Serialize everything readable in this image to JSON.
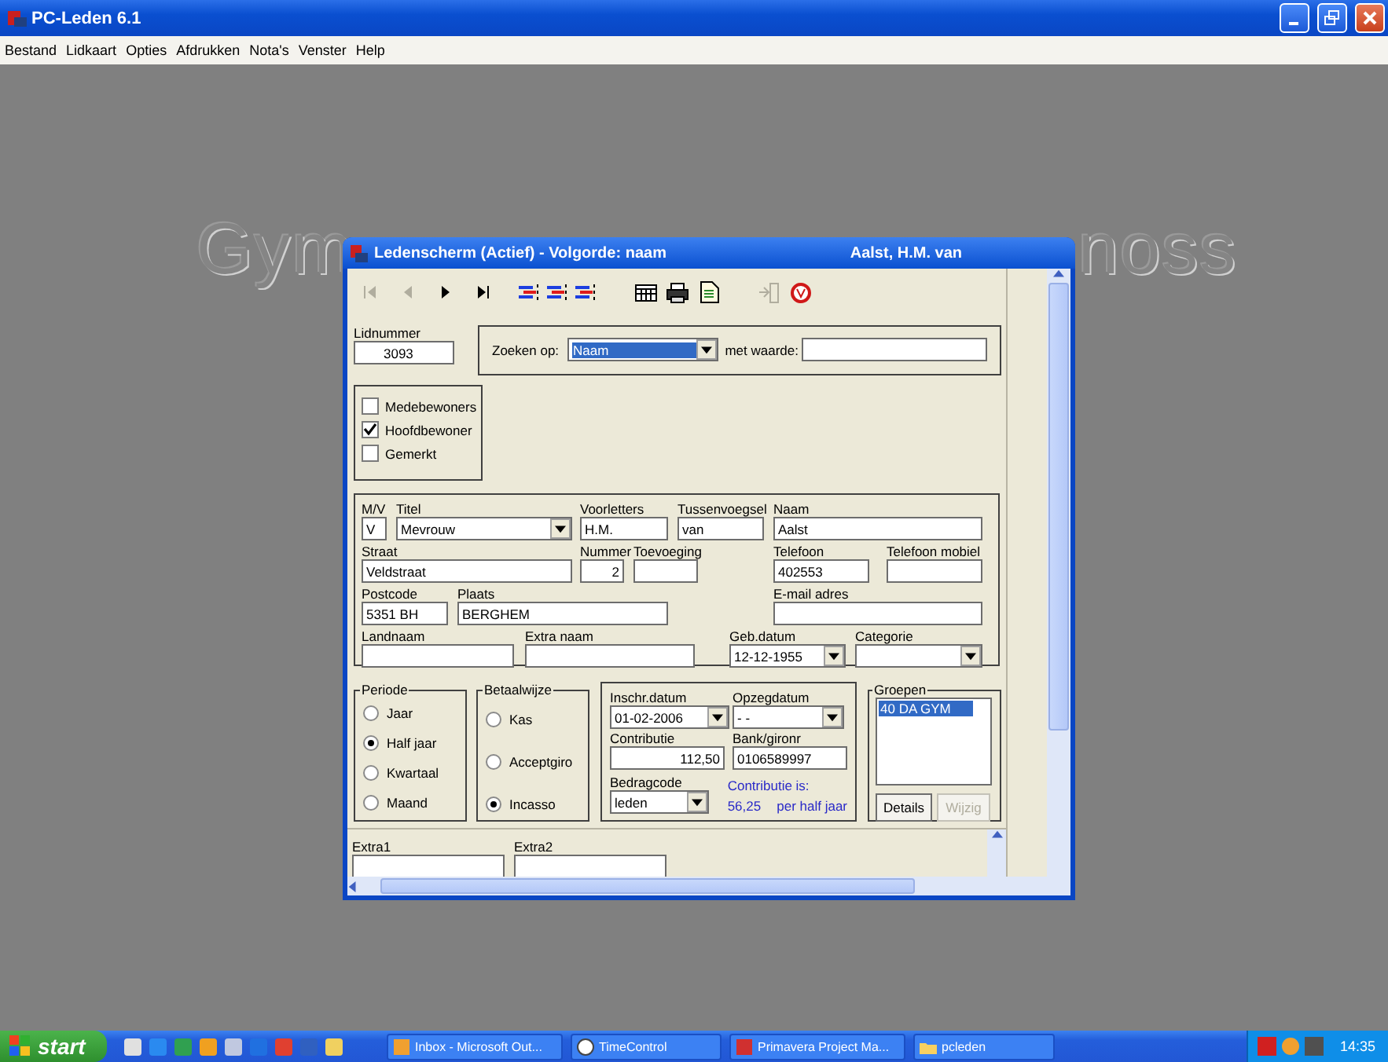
{
  "app": {
    "title": "PC-Leden 6.1"
  },
  "menu": [
    "Bestand",
    "Lidkaart",
    "Opties",
    "Afdrukken",
    "Nota's",
    "Venster",
    "Help"
  ],
  "desktop_title_parts": [
    "Gym",
    "noss"
  ],
  "child_window": {
    "title": "Ledenscherm (Actief) - Volgorde: naam",
    "member": "Aalst, H.M. van"
  },
  "toolbar": [
    {
      "kind": "first",
      "disabled": true
    },
    {
      "kind": "prev",
      "disabled": true
    },
    {
      "kind": "next",
      "disabled": false
    },
    {
      "kind": "last",
      "disabled": false
    },
    {
      "kind": "sort",
      "disabled": false
    },
    {
      "kind": "sort",
      "disabled": false
    },
    {
      "kind": "sort",
      "disabled": false
    },
    {
      "kind": "grid",
      "disabled": false
    },
    {
      "kind": "print",
      "disabled": false
    },
    {
      "kind": "doc",
      "disabled": false
    },
    {
      "kind": "exit",
      "disabled": true
    },
    {
      "kind": "stop",
      "disabled": false
    }
  ],
  "lidnummer": {
    "label": "Lidnummer",
    "value": "3093"
  },
  "search": {
    "label": "Zoeken op:",
    "value": "Naam",
    "highlighted": true,
    "value_label": "met waarde:"
  },
  "flags": [
    {
      "label": "Medebewoners",
      "checked": false
    },
    {
      "label": "Hoofdbewoner",
      "checked": true
    },
    {
      "label": "Gemerkt",
      "checked": false
    }
  ],
  "person": {
    "lines": [
      {
        "fields": [
          {
            "label": "M/V",
            "value": "V",
            "kind": "text"
          },
          {
            "label": "Titel",
            "value": "Mevrouw",
            "kind": "select"
          },
          {
            "label": "Voorletters",
            "value": "H.M.",
            "kind": "text"
          },
          {
            "label": "Tussenvoegsel",
            "value": "van",
            "kind": "text"
          },
          {
            "label": "Naam",
            "value": "Aalst",
            "kind": "text"
          }
        ]
      },
      {
        "fields": [
          {
            "label": "Straat",
            "value": "Veldstraat",
            "kind": "text"
          },
          {
            "label": "Nummer",
            "value": "2",
            "kind": "number"
          },
          {
            "label": "Toevoeging",
            "kind": "text"
          },
          {
            "label": "Telefoon",
            "value": "402553",
            "kind": "text"
          },
          {
            "label": "Telefoon mobiel",
            "kind": "text"
          }
        ]
      },
      {
        "fields": [
          {
            "label": "Postcode",
            "value": "5351 BH",
            "kind": "text"
          },
          {
            "label": "Plaats",
            "value": "BERGHEM",
            "kind": "text"
          },
          {
            "label": "E-mail adres",
            "kind": "text"
          }
        ]
      },
      {
        "fields": [
          {
            "label": "Landnaam",
            "kind": "text"
          },
          {
            "label": "Extra naam",
            "kind": "text"
          },
          {
            "label": "Geb.datum",
            "value": "12-12-1955",
            "kind": "select"
          },
          {
            "label": "Categorie",
            "kind": "select"
          }
        ]
      }
    ]
  },
  "periode": {
    "title": "Periode",
    "options": [
      {
        "label": "Jaar",
        "selected": false
      },
      {
        "label": "Half jaar",
        "selected": true
      },
      {
        "label": "Kwartaal",
        "selected": false
      },
      {
        "label": "Maand",
        "selected": false
      }
    ]
  },
  "betaalwijze": {
    "title": "Betaalwijze",
    "options": [
      {
        "label": "Kas",
        "selected": false
      },
      {
        "label": "Acceptgiro",
        "selected": false
      },
      {
        "label": "Incasso",
        "selected": true
      }
    ]
  },
  "payment": {
    "lines": [
      {
        "fields": [
          {
            "label": "Inschr.datum",
            "value": "01-02-2006",
            "kind": "select"
          },
          {
            "label": "Opzegdatum",
            "value": "- -",
            "kind": "select"
          }
        ]
      },
      {
        "fields": [
          {
            "label": "Contributie",
            "value": "112,50",
            "kind": "number"
          },
          {
            "label": "Bank/gironr",
            "value": "0106589997",
            "kind": "text"
          }
        ]
      },
      {
        "fields": [
          {
            "label": "Bedragcode",
            "value": "leden",
            "kind": "select"
          }
        ]
      }
    ],
    "note": {
      "title": "Contributie is:",
      "amount": "56,25",
      "period": "per half jaar"
    }
  },
  "groepen": {
    "title": "Groepen",
    "items": [
      {
        "label": "40 DA GYM",
        "selected": true
      }
    ],
    "buttons": [
      {
        "label": "Details",
        "disabled": false
      },
      {
        "label": "Wijzig",
        "disabled": true
      }
    ]
  },
  "extra": [
    {
      "label": "Extra1"
    },
    {
      "label": "Extra2"
    }
  ],
  "taskbar": {
    "start": "start",
    "tasks": [
      {
        "label": "Inbox - Microsoft Out...",
        "kind": "mail"
      },
      {
        "label": "TimeControl",
        "kind": "clock"
      },
      {
        "label": "Primavera Project Ma...",
        "kind": "project"
      },
      {
        "label": "pcleden",
        "kind": "folder"
      }
    ],
    "clock": "14:35"
  }
}
